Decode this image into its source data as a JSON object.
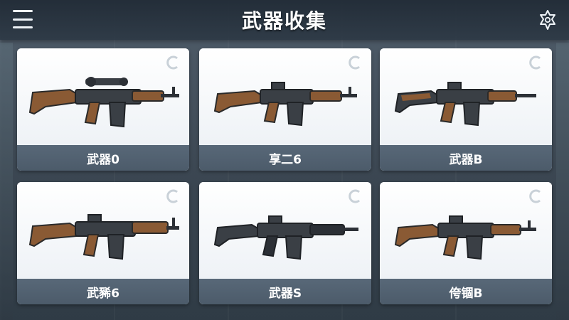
{
  "header": {
    "title": "武器收集",
    "menu_icon": "hamburger-menu-icon",
    "settings_icon": "settings-star-icon"
  },
  "weapons": [
    {
      "name": "武器0",
      "variant": "scoped-rifle"
    },
    {
      "name": "享二6",
      "variant": "assault-rifle"
    },
    {
      "name": "武器B",
      "variant": "carbine"
    },
    {
      "name": "武豨6",
      "variant": "assault-rifle-long"
    },
    {
      "name": "武器S",
      "variant": "black-carbine"
    },
    {
      "name": "侉锢B",
      "variant": "carbine-brown"
    }
  ],
  "colors": {
    "topbar": "#2c3844",
    "card_bg": "#f7f9fb",
    "label_bar": "#526272",
    "wood": "#8a5a34",
    "metal": "#3a3f45"
  }
}
